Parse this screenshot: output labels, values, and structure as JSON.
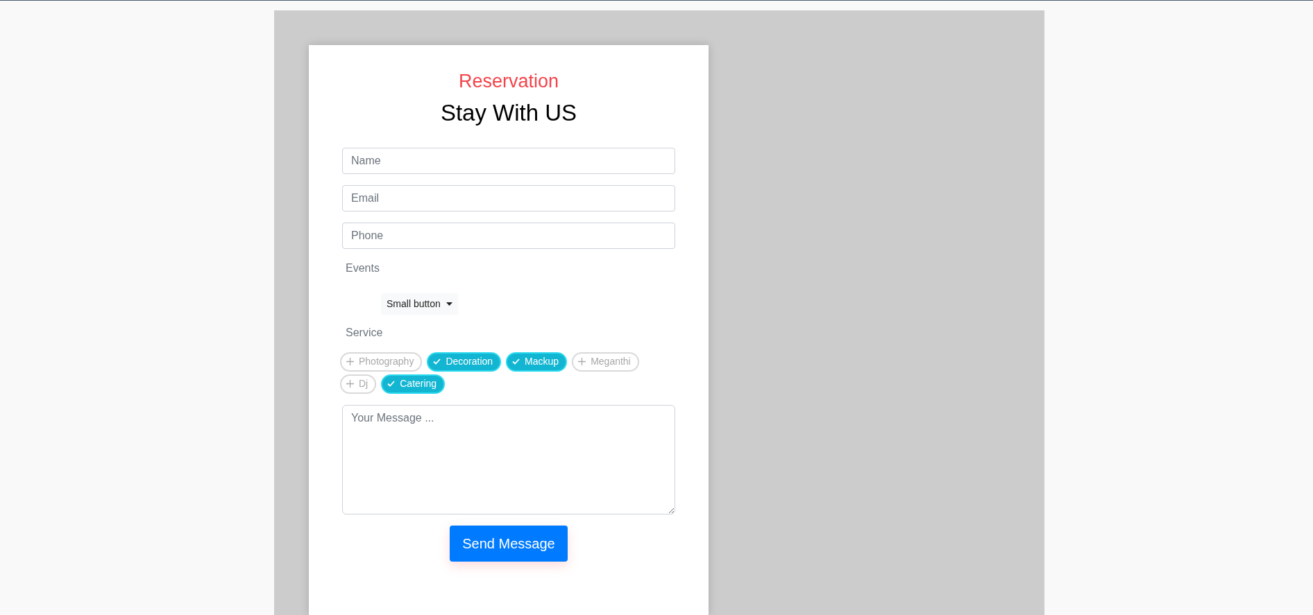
{
  "eyebrow": "Reservation",
  "title": "Stay With US",
  "fields": [
    {
      "placeholder": "Name"
    },
    {
      "placeholder": "Email"
    },
    {
      "placeholder": "Phone"
    }
  ],
  "events": {
    "label": "Events",
    "dropdown": "Small button"
  },
  "service": {
    "label": "Service",
    "chips": [
      {
        "label": "Photography",
        "selected": false
      },
      {
        "label": "Decoration",
        "selected": true
      },
      {
        "label": "Mackup",
        "selected": true
      },
      {
        "label": "Meganthi",
        "selected": false
      },
      {
        "label": "Dj",
        "selected": false
      },
      {
        "label": "Catering",
        "selected": true
      }
    ]
  },
  "message": {
    "placeholder": "Your Message ..."
  },
  "submit": "Send Message"
}
